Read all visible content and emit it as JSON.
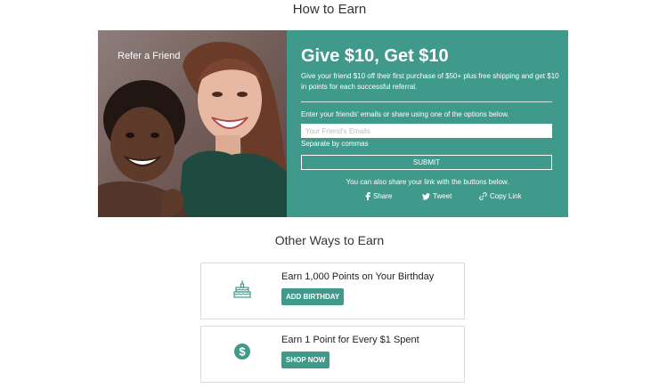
{
  "page": {
    "heading": "How to Earn"
  },
  "referral": {
    "photo_label": "Refer a Friend",
    "title": "Give $10, Get $10",
    "description": "Give your friend $10 off their first purchase of $50+ plus free shipping and get $10 in points for each successful referral.",
    "emails_label": "Enter your friends' emails or share using one of the options below.",
    "emails_placeholder": "Your Friend's Emails",
    "emails_value": "",
    "emails_hint": "Separate by commas",
    "submit_label": "SUBMIT",
    "share_text": "You can also share your link with the buttons below.",
    "share_options": [
      {
        "label": "Share",
        "icon": "facebook-icon"
      },
      {
        "label": "Tweet",
        "icon": "twitter-icon"
      },
      {
        "label": "Copy Link",
        "icon": "link-icon"
      }
    ]
  },
  "other_ways": {
    "heading": "Other Ways to Earn",
    "cards": [
      {
        "title": "Earn 1,000 Points on Your Birthday",
        "button_label": "ADD BIRTHDAY",
        "icon": "birthday-cake-icon"
      },
      {
        "title": "Earn 1 Point for Every $1 Spent",
        "button_label": "SHOP NOW",
        "icon": "dollar-coin-icon"
      }
    ]
  },
  "colors": {
    "accent": "#3f9a8b",
    "text": "#333333",
    "card_border": "#dcdcdc"
  }
}
